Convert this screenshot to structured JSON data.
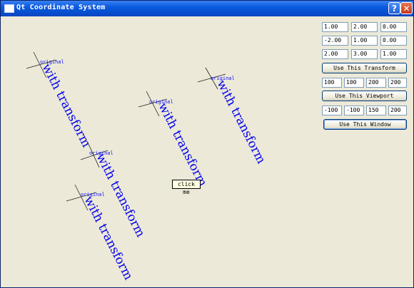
{
  "window": {
    "title": "Qt Coordinate System"
  },
  "transform_matrix": [
    [
      "1.00",
      "2.00",
      "0.00"
    ],
    [
      "-2.00",
      "1.00",
      "0.00"
    ],
    [
      "2.00",
      "3.00",
      "1.00"
    ]
  ],
  "buttons": {
    "transform": "Use This Transform",
    "viewport": "Use This Viewport",
    "window": "Use This Window"
  },
  "viewport_values": [
    "100",
    "100",
    "200",
    "200"
  ],
  "window_values": [
    "-100",
    "-100",
    "150",
    "200"
  ],
  "canvas": {
    "original_label": "original",
    "transformed_text": "with transform",
    "click_label": "click me"
  }
}
